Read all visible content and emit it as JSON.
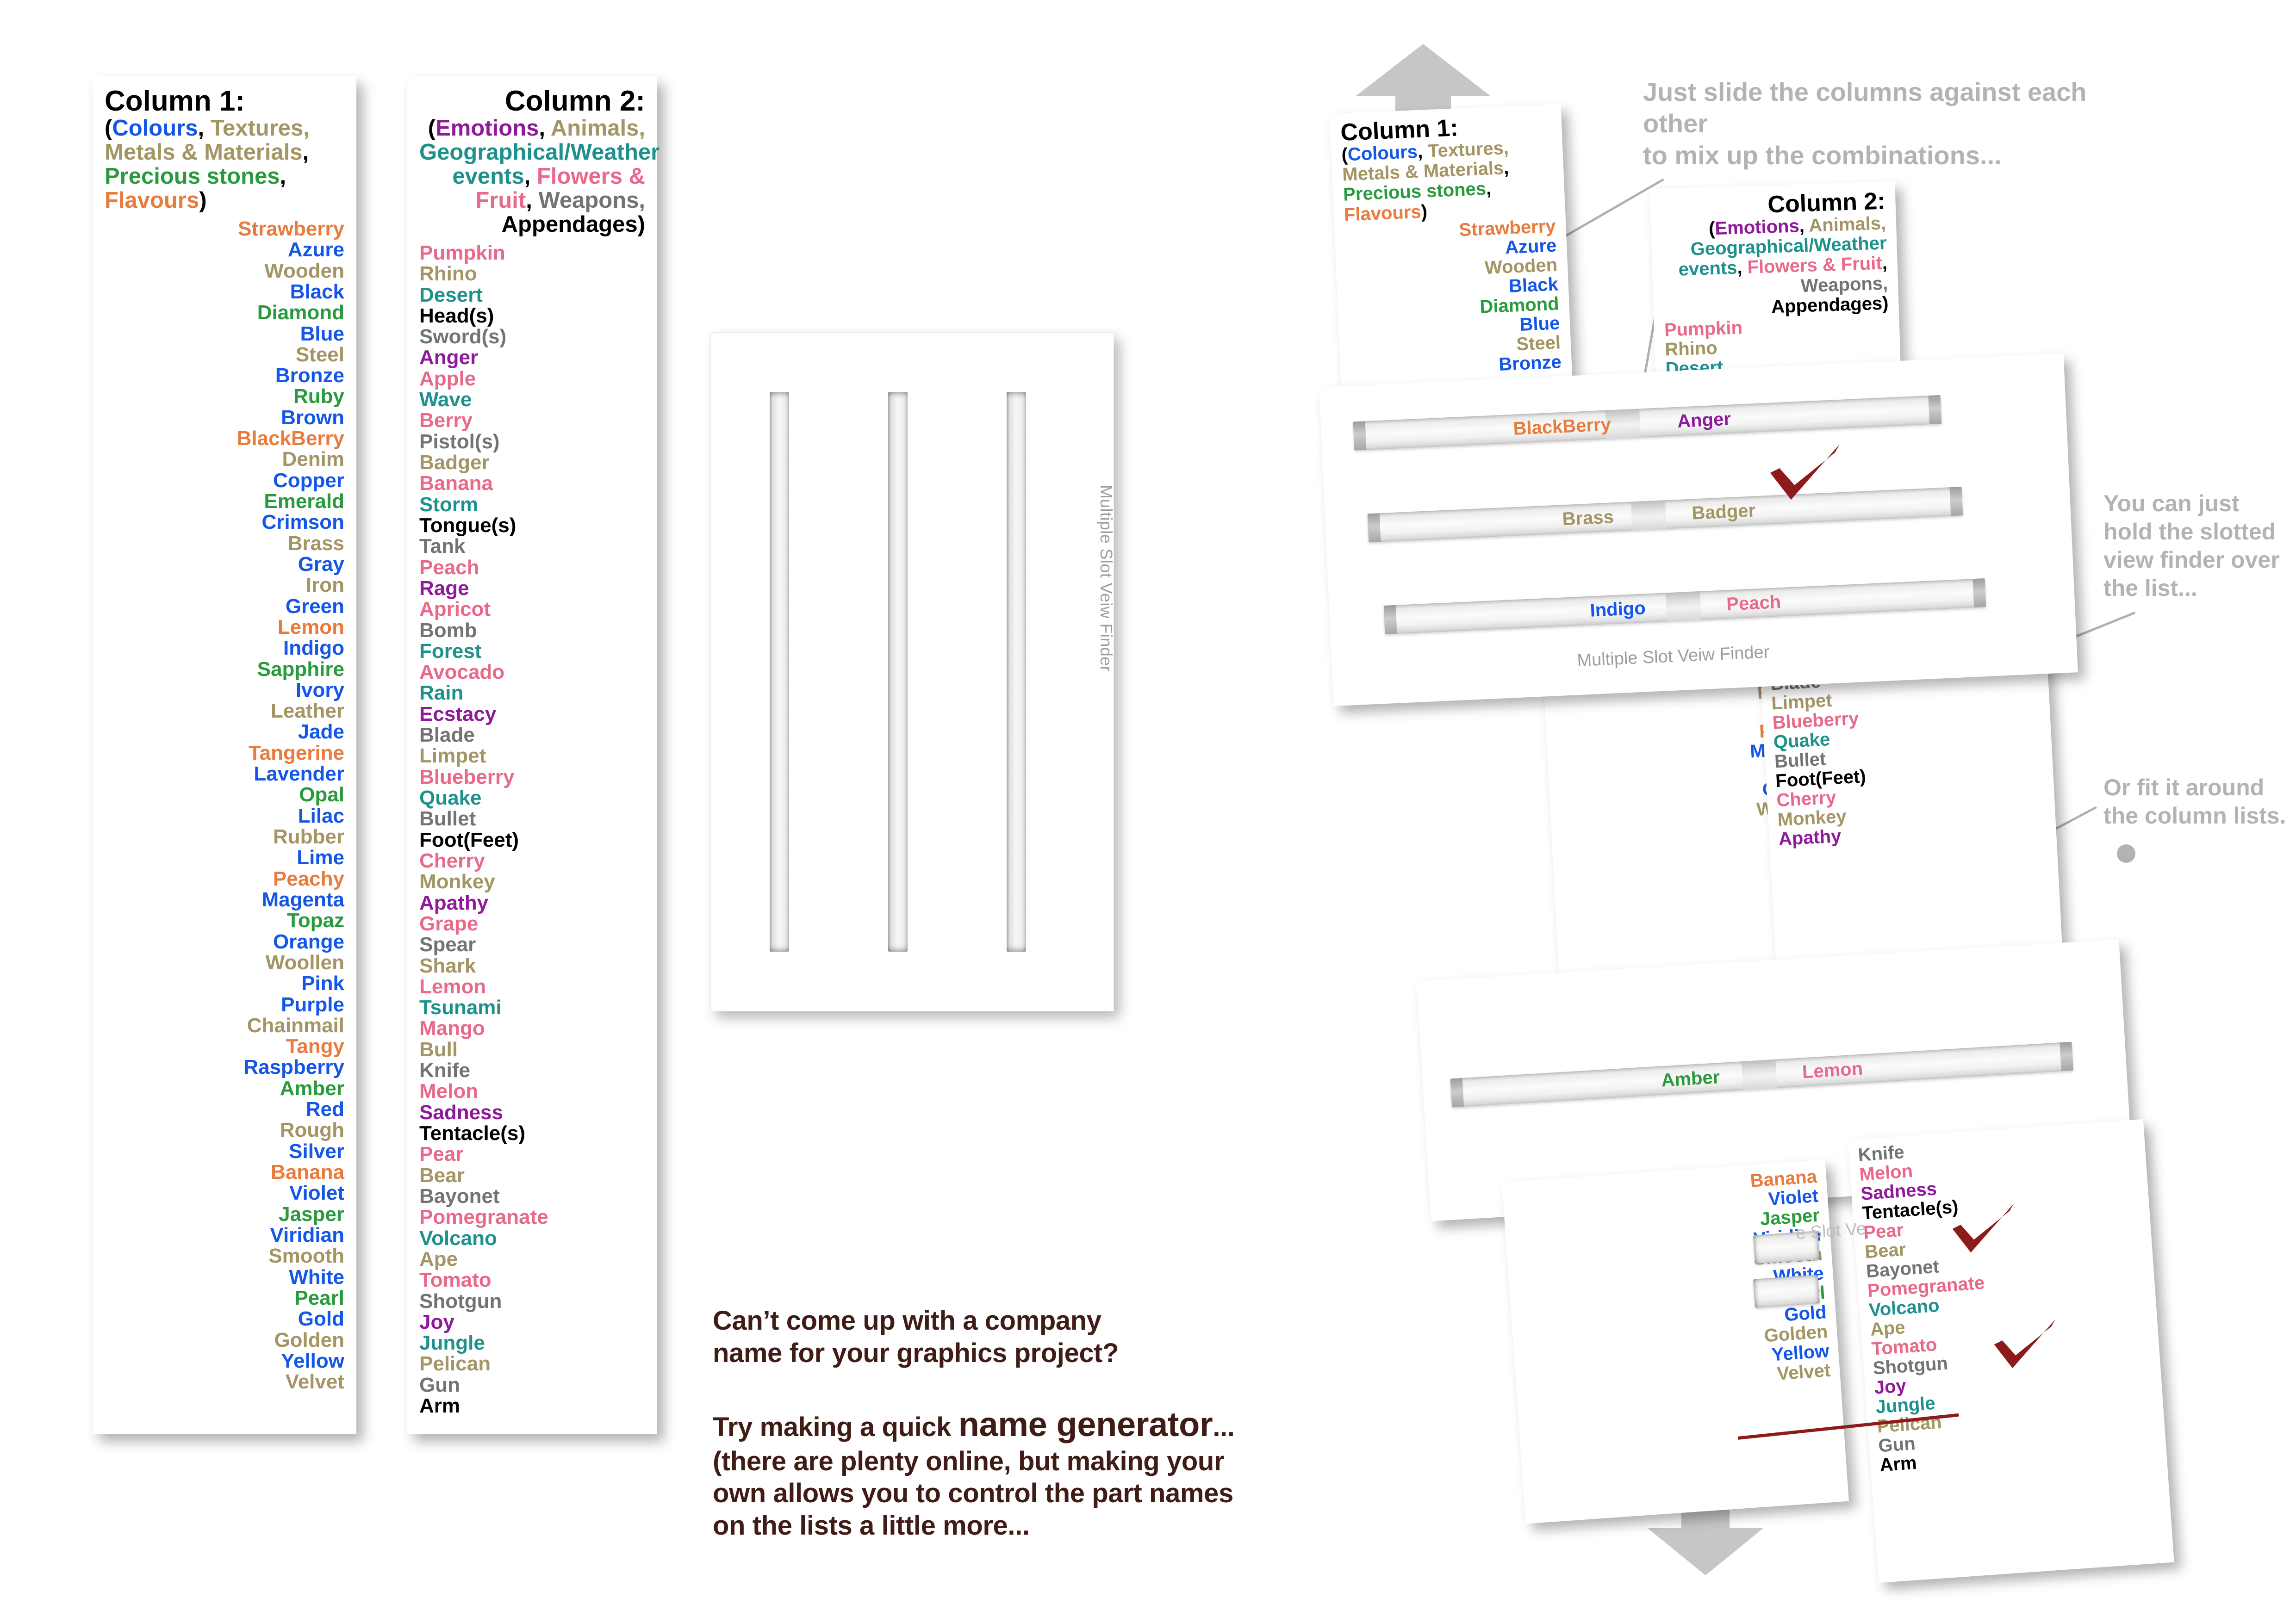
{
  "palette": {
    "colours": "#1356E8",
    "textures": "#A39564",
    "stones": "#2A9A3E",
    "flavours": "#E87B3E",
    "emotions": "#8E1A9B",
    "animals": "#A39564",
    "geo": "#1F918C",
    "flowers": "#E8698A",
    "weapons": "#737373",
    "appendages": "#000000",
    "note_grey": "#B3B3B3",
    "blurb_brown": "#401C16",
    "check_red": "#8E1B1B",
    "arrow_grey": "#C6C6C6",
    "slot_label": "#9D9D9D"
  },
  "column1": {
    "title": "Column 1:",
    "subtitle_parts": [
      {
        "text": "(",
        "cat": "plain"
      },
      {
        "text": "Colours",
        "cat": "colours"
      },
      {
        "text": ", ",
        "cat": "plain"
      },
      {
        "text": "Textures,",
        "cat": "textures"
      },
      {
        "text": "Metals & Materials",
        "cat": "textures"
      },
      {
        "text": ",",
        "cat": "plain"
      },
      {
        "text": "Precious stones",
        "cat": "stones"
      },
      {
        "text": ",",
        "cat": "plain"
      },
      {
        "text": "Flavours",
        "cat": "flavours"
      },
      {
        "text": ")",
        "cat": "plain"
      }
    ],
    "items": [
      {
        "t": "Strawberry",
        "c": "flavours"
      },
      {
        "t": "Azure",
        "c": "colours"
      },
      {
        "t": "Wooden",
        "c": "textures"
      },
      {
        "t": "Black",
        "c": "colours"
      },
      {
        "t": "Diamond",
        "c": "stones"
      },
      {
        "t": "Blue",
        "c": "colours"
      },
      {
        "t": "Steel",
        "c": "textures"
      },
      {
        "t": "Bronze",
        "c": "colours"
      },
      {
        "t": "Ruby",
        "c": "stones"
      },
      {
        "t": "Brown",
        "c": "colours"
      },
      {
        "t": "BlackBerry",
        "c": "flavours"
      },
      {
        "t": "Denim",
        "c": "textures"
      },
      {
        "t": "Copper",
        "c": "colours"
      },
      {
        "t": "Emerald",
        "c": "stones"
      },
      {
        "t": "Crimson",
        "c": "colours"
      },
      {
        "t": "Brass",
        "c": "textures"
      },
      {
        "t": "Gray",
        "c": "colours"
      },
      {
        "t": "Iron",
        "c": "textures"
      },
      {
        "t": "Green",
        "c": "colours"
      },
      {
        "t": "Lemon",
        "c": "flavours"
      },
      {
        "t": "Indigo",
        "c": "colours"
      },
      {
        "t": "Sapphire",
        "c": "stones"
      },
      {
        "t": "Ivory",
        "c": "colours"
      },
      {
        "t": "Leather",
        "c": "textures"
      },
      {
        "t": "Jade",
        "c": "colours"
      },
      {
        "t": "Tangerine",
        "c": "flavours"
      },
      {
        "t": "Lavender",
        "c": "colours"
      },
      {
        "t": "Opal",
        "c": "stones"
      },
      {
        "t": "Lilac",
        "c": "colours"
      },
      {
        "t": "Rubber",
        "c": "textures"
      },
      {
        "t": "Lime",
        "c": "colours"
      },
      {
        "t": "Peachy",
        "c": "flavours"
      },
      {
        "t": "Magenta",
        "c": "colours"
      },
      {
        "t": "Topaz",
        "c": "stones"
      },
      {
        "t": "Orange",
        "c": "colours"
      },
      {
        "t": "Woollen",
        "c": "textures"
      },
      {
        "t": "Pink",
        "c": "colours"
      },
      {
        "t": "Purple",
        "c": "colours"
      },
      {
        "t": "Chainmail",
        "c": "textures"
      },
      {
        "t": "Tangy",
        "c": "flavours"
      },
      {
        "t": "Raspberry",
        "c": "colours"
      },
      {
        "t": "Amber",
        "c": "stones"
      },
      {
        "t": "Red",
        "c": "colours"
      },
      {
        "t": "Rough",
        "c": "textures"
      },
      {
        "t": "Silver",
        "c": "colours"
      },
      {
        "t": "Banana",
        "c": "flavours"
      },
      {
        "t": "Violet",
        "c": "colours"
      },
      {
        "t": "Jasper",
        "c": "stones"
      },
      {
        "t": "Viridian",
        "c": "colours"
      },
      {
        "t": "Smooth",
        "c": "textures"
      },
      {
        "t": "White",
        "c": "colours"
      },
      {
        "t": "Pearl",
        "c": "stones"
      },
      {
        "t": "Gold",
        "c": "colours"
      },
      {
        "t": "Golden",
        "c": "textures"
      },
      {
        "t": "Yellow",
        "c": "colours"
      },
      {
        "t": "Velvet",
        "c": "textures"
      }
    ]
  },
  "column2": {
    "title": "Column 2:",
    "subtitle_parts": [
      {
        "text": "(",
        "cat": "plain"
      },
      {
        "text": "Emotions",
        "cat": "emotions"
      },
      {
        "text": ", ",
        "cat": "plain"
      },
      {
        "text": "Animals,",
        "cat": "animals"
      },
      {
        "text": "Geographical/Weather events",
        "cat": "geo"
      },
      {
        "text": ", ",
        "cat": "plain"
      },
      {
        "text": "Flowers & Fruit",
        "cat": "flowers"
      },
      {
        "text": ", ",
        "cat": "plain"
      },
      {
        "text": "Weapons,",
        "cat": "weapons"
      },
      {
        "text": "Appendages",
        "cat": "appendages"
      },
      {
        "text": ")",
        "cat": "plain"
      }
    ],
    "items": [
      {
        "t": "Pumpkin",
        "c": "flowers"
      },
      {
        "t": "Rhino",
        "c": "animals"
      },
      {
        "t": "Desert",
        "c": "geo"
      },
      {
        "t": "Head(s)",
        "c": "appendages"
      },
      {
        "t": "Sword(s)",
        "c": "weapons"
      },
      {
        "t": "Anger",
        "c": "emotions"
      },
      {
        "t": "Apple",
        "c": "flowers"
      },
      {
        "t": "Wave",
        "c": "geo"
      },
      {
        "t": "Berry",
        "c": "flowers"
      },
      {
        "t": "Pistol(s)",
        "c": "weapons"
      },
      {
        "t": "Badger",
        "c": "animals"
      },
      {
        "t": "Banana",
        "c": "flowers"
      },
      {
        "t": "Storm",
        "c": "geo"
      },
      {
        "t": "Tongue(s)",
        "c": "appendages"
      },
      {
        "t": "Tank",
        "c": "weapons"
      },
      {
        "t": "Peach",
        "c": "flowers"
      },
      {
        "t": "Rage",
        "c": "emotions"
      },
      {
        "t": "Apricot",
        "c": "flowers"
      },
      {
        "t": "Bomb",
        "c": "weapons"
      },
      {
        "t": "Forest",
        "c": "geo"
      },
      {
        "t": "Avocado",
        "c": "flowers"
      },
      {
        "t": "Rain",
        "c": "geo"
      },
      {
        "t": "Ecstacy",
        "c": "emotions"
      },
      {
        "t": "Blade",
        "c": "weapons"
      },
      {
        "t": "Limpet",
        "c": "animals"
      },
      {
        "t": "Blueberry",
        "c": "flowers"
      },
      {
        "t": "Quake",
        "c": "geo"
      },
      {
        "t": "Bullet",
        "c": "weapons"
      },
      {
        "t": "Foot(Feet)",
        "c": "appendages"
      },
      {
        "t": "Cherry",
        "c": "flowers"
      },
      {
        "t": "Monkey",
        "c": "animals"
      },
      {
        "t": "Apathy",
        "c": "emotions"
      },
      {
        "t": "Grape",
        "c": "flowers"
      },
      {
        "t": "Spear",
        "c": "weapons"
      },
      {
        "t": "Shark",
        "c": "animals"
      },
      {
        "t": "Lemon",
        "c": "flowers"
      },
      {
        "t": "Tsunami",
        "c": "geo"
      },
      {
        "t": "Mango",
        "c": "flowers"
      },
      {
        "t": "Bull",
        "c": "animals"
      },
      {
        "t": "Knife",
        "c": "weapons"
      },
      {
        "t": "Melon",
        "c": "flowers"
      },
      {
        "t": "Sadness",
        "c": "emotions"
      },
      {
        "t": "Tentacle(s)",
        "c": "appendages"
      },
      {
        "t": "Pear",
        "c": "flowers"
      },
      {
        "t": "Bear",
        "c": "animals"
      },
      {
        "t": "Bayonet",
        "c": "weapons"
      },
      {
        "t": "Pomegranate",
        "c": "flowers"
      },
      {
        "t": "Volcano",
        "c": "geo"
      },
      {
        "t": "Ape",
        "c": "animals"
      },
      {
        "t": "Tomato",
        "c": "flowers"
      },
      {
        "t": "Shotgun",
        "c": "weapons"
      },
      {
        "t": "Joy",
        "c": "emotions"
      },
      {
        "t": "Jungle",
        "c": "geo"
      },
      {
        "t": "Pelican",
        "c": "animals"
      },
      {
        "t": "Gun",
        "c": "weapons"
      },
      {
        "t": "Arm",
        "c": "appendages"
      }
    ]
  },
  "viewfinder": {
    "label": "Multiple Slot Veiw Finder",
    "slot_count": 3
  },
  "blurb": {
    "line1": "Can’t come up with a company",
    "line2": "name for your graphics project?",
    "line3a": "Try making a quick ",
    "line3b": "name generator",
    "line3c": "...",
    "line4": "(there are plenty online, but making your",
    "line5": "own allows you to control the part names",
    "line6": "on the lists a little more..."
  },
  "notes": {
    "slide": "Just slide the columns against each other to mix up the combinations...",
    "slide_l1": "Just slide the columns against each other",
    "slide_l2": "to mix up the combinations...",
    "hold_l1": "You can just",
    "hold_l2": "hold the slotted",
    "hold_l3": "view finder over",
    "hold_l4": "the list...",
    "fit_l1": "Or fit it around",
    "fit_l2": "the column lists."
  },
  "slot_rows": [
    {
      "left": "BlackBerry",
      "left_c": "flavours",
      "right": "Anger",
      "right_c": "emotions"
    },
    {
      "left": "Brass",
      "left_c": "textures",
      "right": "Badger",
      "right_c": "animals"
    },
    {
      "left": "Indigo",
      "left_c": "colours",
      "right": "Peach",
      "right_c": "flowers"
    },
    {
      "left": "Amber",
      "left_c": "stones",
      "right": "Lemon",
      "right_c": "flowers"
    }
  ],
  "mini_viewfinder_label": "Multiple Slot Veiw Finder",
  "mini_viewfinder_label_partial": "e Slot Ve"
}
